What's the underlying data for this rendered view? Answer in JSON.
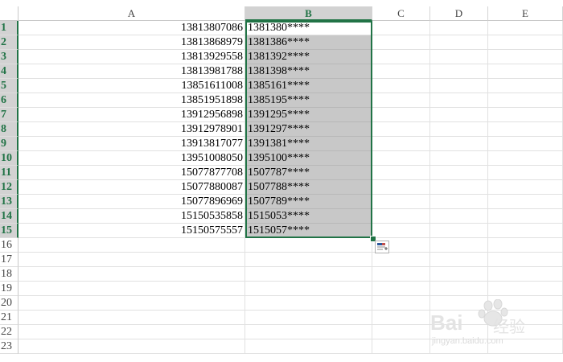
{
  "sheet": {
    "columns": [
      "A",
      "B",
      "C",
      "D",
      "E"
    ],
    "selected_column": "B",
    "row_numbers": [
      "1",
      "2",
      "3",
      "4",
      "5",
      "6",
      "7",
      "8",
      "9",
      "10",
      "11",
      "12",
      "13",
      "14",
      "15",
      "16",
      "17",
      "18",
      "19",
      "20",
      "21",
      "22",
      "23"
    ],
    "selected_rows": 15,
    "column_a": [
      "13813807086",
      "13813868979",
      "13813929558",
      "13813981788",
      "13851611008",
      "13851951898",
      "13912956898",
      "13912978901",
      "13913817077",
      "13951008050",
      "15077877708",
      "15077880087",
      "15077896969",
      "15150535858",
      "15150575557"
    ],
    "column_b": [
      "1381380****",
      "1381386****",
      "1381392****",
      "1381398****",
      "1385161****",
      "1385195****",
      "1391295****",
      "1391297****",
      "1391381****",
      "1395100****",
      "1507787****",
      "1507788****",
      "1507789****",
      "1515053****",
      "1515057****"
    ]
  },
  "icons": {
    "fill_handle": "fill-handle-icon",
    "quick_analysis": "quick-analysis-icon"
  },
  "colors": {
    "accent": "#217346",
    "selection_fill": "#c8c8c8",
    "header_selected": "#d2d2d2"
  },
  "watermark": {
    "brand": "Bai",
    "cn": "经验",
    "url": "jingyan.baidu.com"
  }
}
